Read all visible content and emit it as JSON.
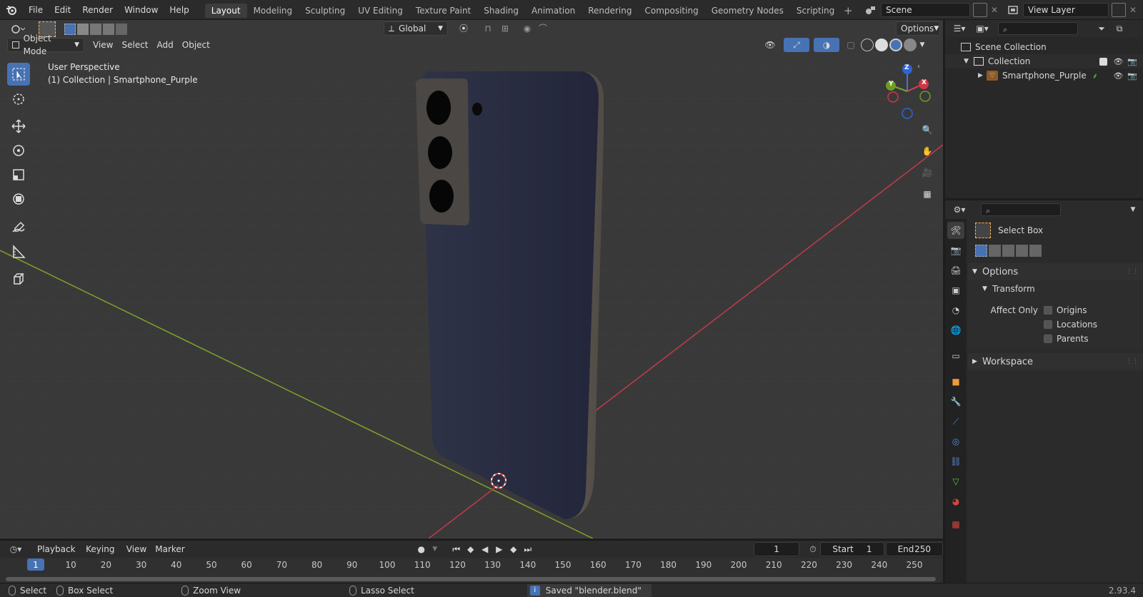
{
  "menu": {
    "file": "File",
    "edit": "Edit",
    "render": "Render",
    "window": "Window",
    "help": "Help"
  },
  "workspace_tabs": [
    "Layout",
    "Modeling",
    "Sculpting",
    "UV Editing",
    "Texture Paint",
    "Shading",
    "Animation",
    "Rendering",
    "Compositing",
    "Geometry Nodes",
    "Scripting"
  ],
  "scene": {
    "name": "Scene",
    "view_layer": "View Layer"
  },
  "viewport": {
    "mode": "Object Mode",
    "menus": {
      "view": "View",
      "select": "Select",
      "add": "Add",
      "object": "Object"
    },
    "orientation": "Global",
    "options": "Options",
    "overlay_title": "User Perspective",
    "overlay_sub": "(1) Collection | Smartphone_Purple",
    "gizmo_x": "X",
    "gizmo_y": "Y",
    "gizmo_z": "Z"
  },
  "outliner": {
    "scene_collection": "Scene Collection",
    "collection": "Collection",
    "object": "Smartphone_Purple"
  },
  "properties": {
    "tool_name": "Select Box",
    "options": "Options",
    "transform": "Transform",
    "affect_only": "Affect Only",
    "origins": "Origins",
    "locations": "Locations",
    "parents": "Parents",
    "workspace": "Workspace"
  },
  "timeline": {
    "playback": "Playback",
    "keying": "Keying",
    "view": "View",
    "marker": "Marker",
    "current_frame": "1",
    "start_label": "Start",
    "start": "1",
    "end_label": "End",
    "end": "250",
    "ticks": [
      "1",
      "10",
      "20",
      "30",
      "40",
      "50",
      "60",
      "70",
      "80",
      "90",
      "100",
      "110",
      "120",
      "130",
      "140",
      "150",
      "160",
      "170",
      "180",
      "190",
      "200",
      "210",
      "220",
      "230",
      "240",
      "250"
    ]
  },
  "status": {
    "select": "Select",
    "box_select": "Box Select",
    "zoom_view": "Zoom View",
    "lasso_select": "Lasso Select",
    "message": "Saved \"blender.blend\"",
    "version": "2.93.4"
  },
  "colors": {
    "accent": "#4772b3",
    "phone_body": "#2c2f44",
    "axis_x": "#c23b4b",
    "axis_y": "#7ea22a"
  }
}
